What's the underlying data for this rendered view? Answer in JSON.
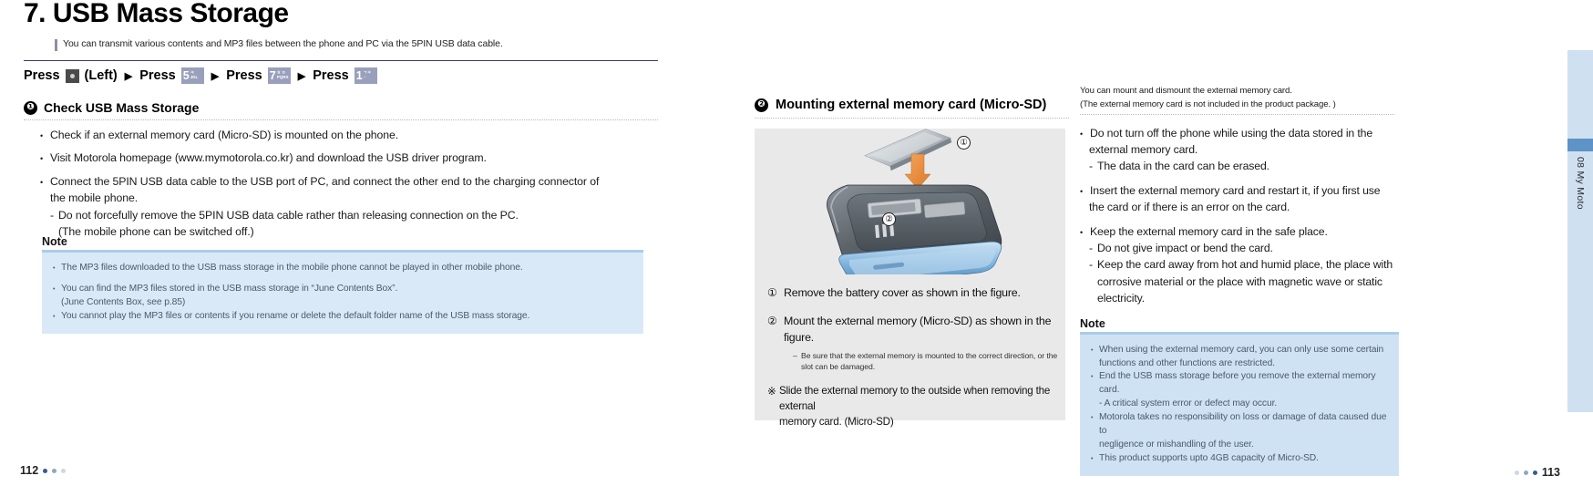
{
  "left": {
    "title": "7. USB Mass Storage",
    "subtitle": "You can transmit various contents and MP3 files between the phone and PC via the 5PIN USB data cable.",
    "press_sequence": {
      "label1": "Press",
      "soft_key_suffix": "(Left)",
      "label2": "Press",
      "key1_digit": "5",
      "key1_sub_top": "ㅋ",
      "key1_sub_bottom": "JKL",
      "label3": "Press",
      "key2_digit": "7",
      "key2_sub_top": "ㅎ ㅇ",
      "key2_sub_bottom": "PQRS",
      "label4": "Press",
      "key3_digit": "1",
      "key3_sub_top": "ㄱㅋ",
      "key3_sub_bottom": "··",
      "arrow": "▶"
    },
    "section": {
      "number": "❶",
      "heading": "Check USB Mass Storage"
    },
    "bullets": [
      {
        "type": "bullet",
        "text": "Check if an external memory card (Micro-SD) is mounted on the phone."
      },
      {
        "type": "bullet",
        "text": "Visit Motorola homepage (www.mymotorola.co.kr) and download the USB driver program."
      },
      {
        "type": "bullet",
        "text": "Connect the 5PIN USB data cable to the USB port of PC, and connect the other end to the charging connector of"
      },
      {
        "type": "cont",
        "text": "the mobile phone."
      },
      {
        "type": "dash",
        "text": "Do not forcefully remove the 5PIN USB data cable rather than releasing connection on the PC."
      },
      {
        "type": "cont2",
        "text": "(The mobile phone can be switched off.)"
      }
    ],
    "note": {
      "label": "Note",
      "items": [
        {
          "type": "bullet",
          "text": "The MP3 files downloaded to the USB mass storage in the mobile phone cannot be played in other mobile phone."
        },
        {
          "type": "bullet",
          "text": "You can find the MP3 files stored in the USB mass storage in “June Contents Box”."
        },
        {
          "type": "cont",
          "text": "(June Contents Box, see p.85)"
        },
        {
          "type": "bullet",
          "text": "You cannot play the MP3 files or contents if you rename or delete the default folder name of the USB mass storage."
        }
      ]
    },
    "folio": "112"
  },
  "right": {
    "section": {
      "number": "❷",
      "heading": "Mounting external memory card (Micro-SD)"
    },
    "intro_line1": "You can mount and dismount the external memory card.",
    "intro_line2": "(The external memory card is not included in the product package. )",
    "figure": {
      "callout_1": "①",
      "callout_2": "②",
      "captions": [
        {
          "mark": "①",
          "text": "Remove the battery cover as shown in the figure."
        },
        {
          "mark": "②",
          "text": "Mount the external memory (Micro-SD) as shown in the figure."
        }
      ],
      "sub_note_line1": "Be sure that the external memory is mounted to the correct direction, or the",
      "sub_note_line2": "slot can be damaged.",
      "star_mark": "※",
      "star_line1": "Slide the external memory to the outside when removing the external",
      "star_line2": "memory card. (Micro-SD)"
    },
    "bullets": [
      {
        "type": "bullet",
        "text": "Do not turn off the phone while using the data stored in the"
      },
      {
        "type": "cont",
        "text": "external memory card."
      },
      {
        "type": "dash",
        "text": "The data in the card can be erased."
      },
      {
        "type": "bullet",
        "text": "Insert the external memory card and restart it, if you first use"
      },
      {
        "type": "cont",
        "text": "the card or if there is an error on the card."
      },
      {
        "type": "bullet",
        "text": "Keep the external memory card in the safe place."
      },
      {
        "type": "dash",
        "text": "Do not give impact or bend the card."
      },
      {
        "type": "dash",
        "text": "Keep the card away from hot and humid place, the place with"
      },
      {
        "type": "cont2",
        "text": "corrosive material or the place with magnetic wave or static"
      },
      {
        "type": "cont2",
        "text": "electricity."
      }
    ],
    "note": {
      "label": "Note",
      "items": [
        {
          "type": "bullet",
          "text": "When using the external memory card, you can only use some certain"
        },
        {
          "type": "cont",
          "text": "functions and other functions are restricted."
        },
        {
          "type": "bullet",
          "text": "End the USB mass storage before you remove the external memory card."
        },
        {
          "type": "dash",
          "text": "A critical system error or defect may occur."
        },
        {
          "type": "bullet",
          "text": "Motorola takes no responsibility on loss or damage of data caused due to"
        },
        {
          "type": "cont",
          "text": "negligence or mishandling of the user."
        },
        {
          "type": "bullet",
          "text": "This product supports upto 4GB capacity of Micro-SD."
        }
      ]
    },
    "tab_label": "08 My Moto",
    "folio": "113"
  },
  "colors": {
    "title_rule": "#3b3b6e",
    "note_bg": "#d9e9f7",
    "note_rule": "#a9cde9",
    "tab_bg": "#cfe0f1",
    "tab_accent": "#5d93c6",
    "key_bg": "#99a0bb"
  }
}
